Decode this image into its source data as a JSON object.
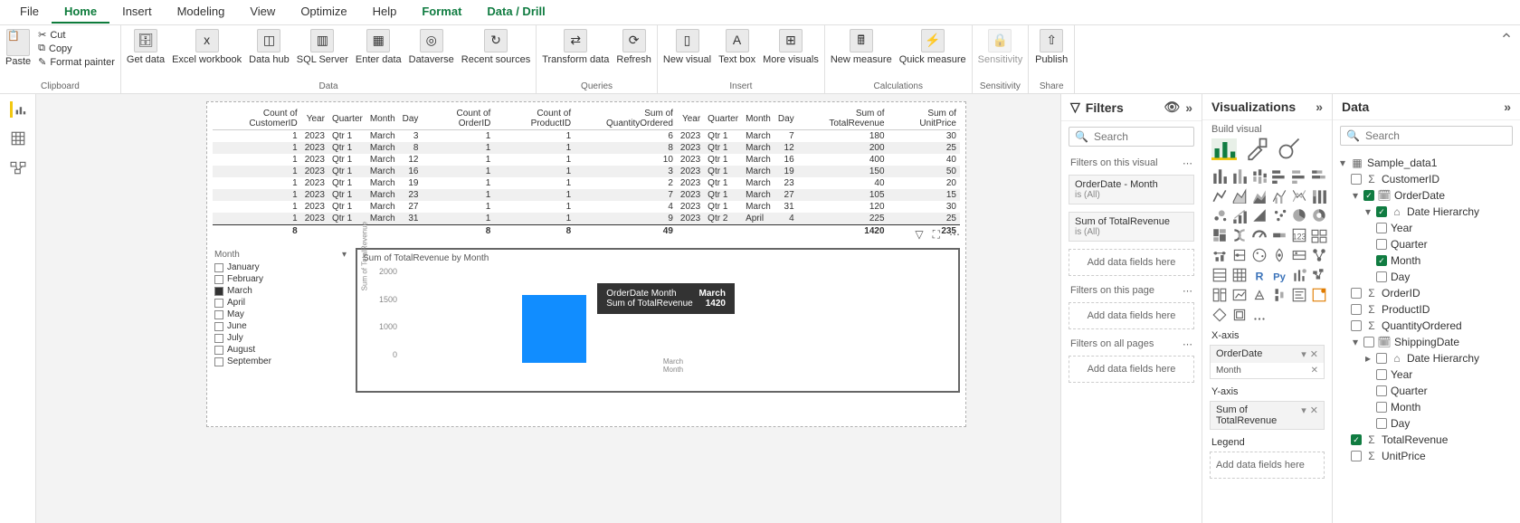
{
  "menu": [
    "File",
    "Home",
    "Insert",
    "Modeling",
    "View",
    "Optimize",
    "Help",
    "Format",
    "Data / Drill"
  ],
  "menu_active": "Home",
  "menu_context": [
    "Format",
    "Data / Drill"
  ],
  "ribbon": {
    "clipboard": {
      "paste": "Paste",
      "cut": "Cut",
      "copy": "Copy",
      "format_painter": "Format painter",
      "group": "Clipboard"
    },
    "data": {
      "get": "Get\ndata",
      "excel": "Excel\nworkbook",
      "hub": "Data\nhub",
      "sql": "SQL\nServer",
      "enter": "Enter\ndata",
      "dataverse": "Dataverse",
      "recent": "Recent\nsources",
      "group": "Data"
    },
    "queries": {
      "transform": "Transform\ndata",
      "refresh": "Refresh",
      "group": "Queries"
    },
    "insert": {
      "new_visual": "New\nvisual",
      "text_box": "Text\nbox",
      "more": "More\nvisuals",
      "group": "Insert"
    },
    "calc": {
      "new_measure": "New\nmeasure",
      "quick": "Quick\nmeasure",
      "group": "Calculations"
    },
    "sens": {
      "sensitivity": "Sensitivity",
      "group": "Sensitivity"
    },
    "share": {
      "publish": "Publish",
      "group": "Share"
    }
  },
  "table": {
    "headers": [
      "Count of CustomerID",
      "Year",
      "Quarter",
      "Month",
      "Day",
      "Count of OrderID",
      "Count of ProductID",
      "Sum of QuantityOrdered",
      "Year",
      "Quarter",
      "Month",
      "Day",
      "Sum of TotalRevenue",
      "Sum of UnitPrice"
    ],
    "rows": [
      [
        "1",
        "2023",
        "Qtr 1",
        "March",
        "3",
        "1",
        "1",
        "6",
        "2023",
        "Qtr 1",
        "March",
        "7",
        "180",
        "30"
      ],
      [
        "1",
        "2023",
        "Qtr 1",
        "March",
        "8",
        "1",
        "1",
        "8",
        "2023",
        "Qtr 1",
        "March",
        "12",
        "200",
        "25"
      ],
      [
        "1",
        "2023",
        "Qtr 1",
        "March",
        "12",
        "1",
        "1",
        "10",
        "2023",
        "Qtr 1",
        "March",
        "16",
        "400",
        "40"
      ],
      [
        "1",
        "2023",
        "Qtr 1",
        "March",
        "16",
        "1",
        "1",
        "3",
        "2023",
        "Qtr 1",
        "March",
        "19",
        "150",
        "50"
      ],
      [
        "1",
        "2023",
        "Qtr 1",
        "March",
        "19",
        "1",
        "1",
        "2",
        "2023",
        "Qtr 1",
        "March",
        "23",
        "40",
        "20"
      ],
      [
        "1",
        "2023",
        "Qtr 1",
        "March",
        "23",
        "1",
        "1",
        "7",
        "2023",
        "Qtr 1",
        "March",
        "27",
        "105",
        "15"
      ],
      [
        "1",
        "2023",
        "Qtr 1",
        "March",
        "27",
        "1",
        "1",
        "4",
        "2023",
        "Qtr 1",
        "March",
        "31",
        "120",
        "30"
      ],
      [
        "1",
        "2023",
        "Qtr 1",
        "March",
        "31",
        "1",
        "1",
        "9",
        "2023",
        "Qtr 2",
        "April",
        "4",
        "225",
        "25"
      ]
    ],
    "totals": [
      "8",
      "",
      "",
      "",
      "",
      "8",
      "8",
      "49",
      "",
      "",
      "",
      "",
      "1420",
      "235"
    ]
  },
  "slicer": {
    "header": "Month",
    "items": [
      {
        "label": "January",
        "checked": false
      },
      {
        "label": "February",
        "checked": false
      },
      {
        "label": "March",
        "checked": true
      },
      {
        "label": "April",
        "checked": false
      },
      {
        "label": "May",
        "checked": false
      },
      {
        "label": "June",
        "checked": false
      },
      {
        "label": "July",
        "checked": false
      },
      {
        "label": "August",
        "checked": false
      },
      {
        "label": "September",
        "checked": false
      }
    ]
  },
  "chart_data": {
    "type": "bar",
    "title": "Sum of TotalRevenue by Month",
    "categories": [
      "March"
    ],
    "values": [
      1420
    ],
    "ylabel": "Sum of TotalRevenue",
    "xlabel": "Month",
    "ylim": [
      0,
      2000
    ],
    "yticks": [
      0,
      1000,
      1500,
      2000
    ],
    "tooltip": {
      "line1_label": "OrderDate Month",
      "line1_value": "March",
      "line2_label": "Sum of TotalRevenue",
      "line2_value": "1420"
    }
  },
  "filters": {
    "title": "Filters",
    "search_ph": "Search",
    "section_visual": "Filters on this visual",
    "cards": [
      {
        "title": "OrderDate - Month",
        "sub": "is (All)"
      },
      {
        "title": "Sum of TotalRevenue",
        "sub": "is (All)"
      }
    ],
    "drop_visual": "Add data fields here",
    "section_page": "Filters on this page",
    "drop_page": "Add data fields here",
    "section_all": "Filters on all pages",
    "drop_all": "Add data fields here"
  },
  "viz": {
    "title": "Visualizations",
    "subtitle": "Build visual",
    "xaxis": "X-axis",
    "xfield": "OrderDate",
    "xsub": "Month",
    "yaxis": "Y-axis",
    "yfield": "Sum of TotalRevenue",
    "legend": "Legend",
    "legend_drop": "Add data fields here"
  },
  "data_pane": {
    "title": "Data",
    "search_ph": "Search",
    "table_name": "Sample_data1",
    "fields": {
      "customer": "CustomerID",
      "orderdate": "OrderDate",
      "date_hier": "Date Hierarchy",
      "year": "Year",
      "quarter": "Quarter",
      "month": "Month",
      "day": "Day",
      "orderid": "OrderID",
      "productid": "ProductID",
      "qty": "QuantityOrdered",
      "shipdate": "ShippingDate",
      "date_hier2": "Date Hierarchy",
      "totalrev": "TotalRevenue",
      "unitprice": "UnitPrice"
    }
  }
}
